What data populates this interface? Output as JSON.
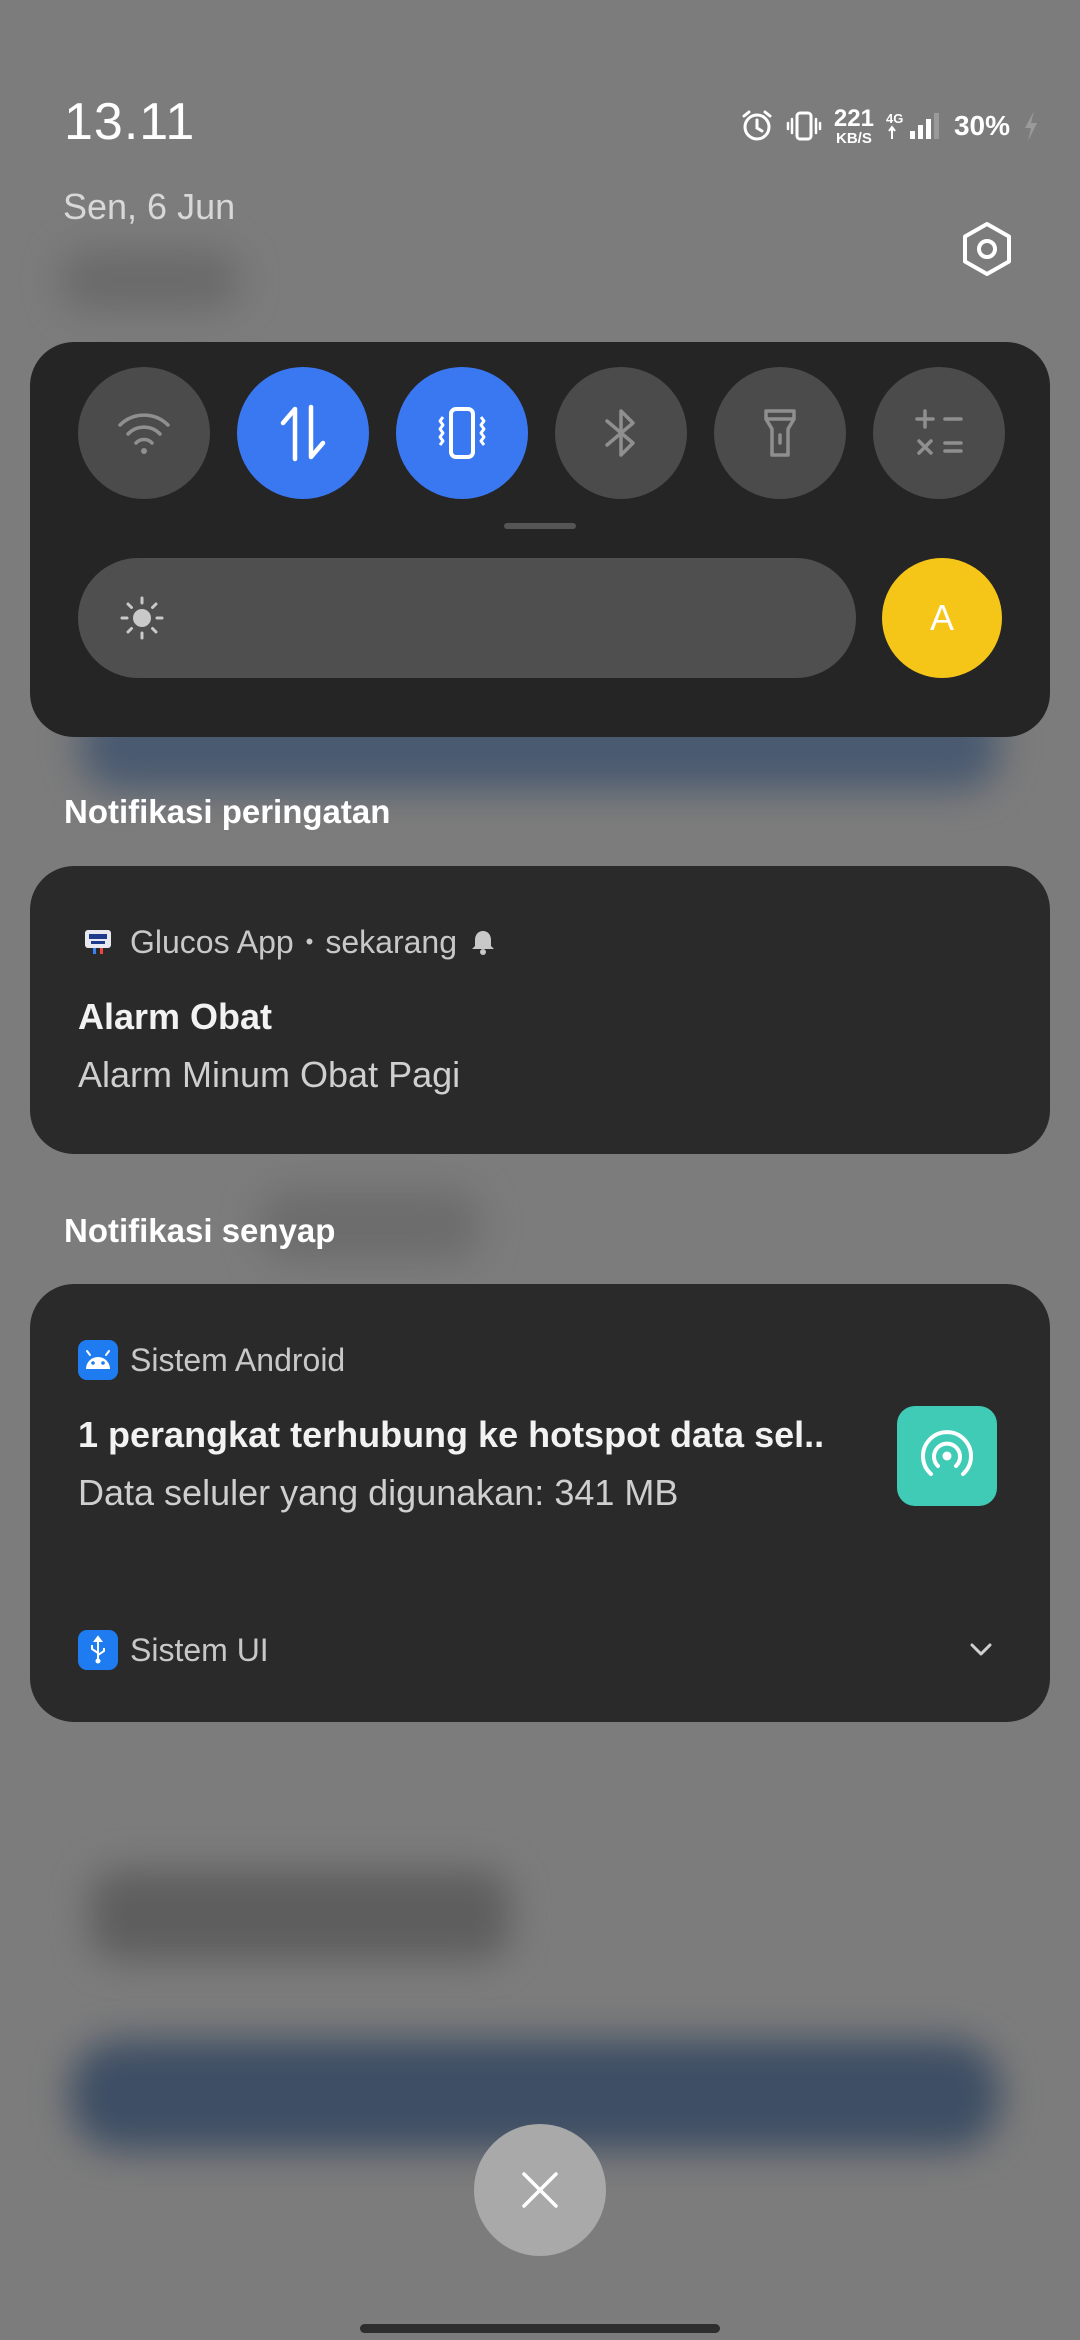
{
  "status_bar": {
    "time": "13.11",
    "date": "Sen, 6 Jun",
    "net_speed_value": "221",
    "net_speed_unit": "KB/S",
    "network_type": "4G",
    "battery": "30%"
  },
  "quick_settings": {
    "tiles": [
      {
        "icon": "wifi-icon",
        "active": false
      },
      {
        "icon": "mobile-data-icon",
        "active": true
      },
      {
        "icon": "vibrate-icon",
        "active": true
      },
      {
        "icon": "bluetooth-icon",
        "active": false
      },
      {
        "icon": "flashlight-icon",
        "active": false
      },
      {
        "icon": "calculator-icon",
        "active": false
      }
    ],
    "brightness_icon": "sun-icon",
    "auto_brightness_label": "A",
    "colors": {
      "active_tile": "#3a78f2",
      "auto_brightness": "#f5c518"
    }
  },
  "sections": {
    "alerting_title": "Notifikasi peringatan",
    "silent_title": "Notifikasi senyap"
  },
  "notifications": [
    {
      "app": "Glucos App",
      "time": "sekarang",
      "title": "Alarm Obat",
      "text": "Alarm Minum Obat Pagi"
    },
    {
      "app": "Sistem Android",
      "title": "1 perangkat terhubung ke hotspot data sel..",
      "text": "Data seluler yang digunakan: 341 MB"
    },
    {
      "app": "Sistem UI"
    }
  ]
}
